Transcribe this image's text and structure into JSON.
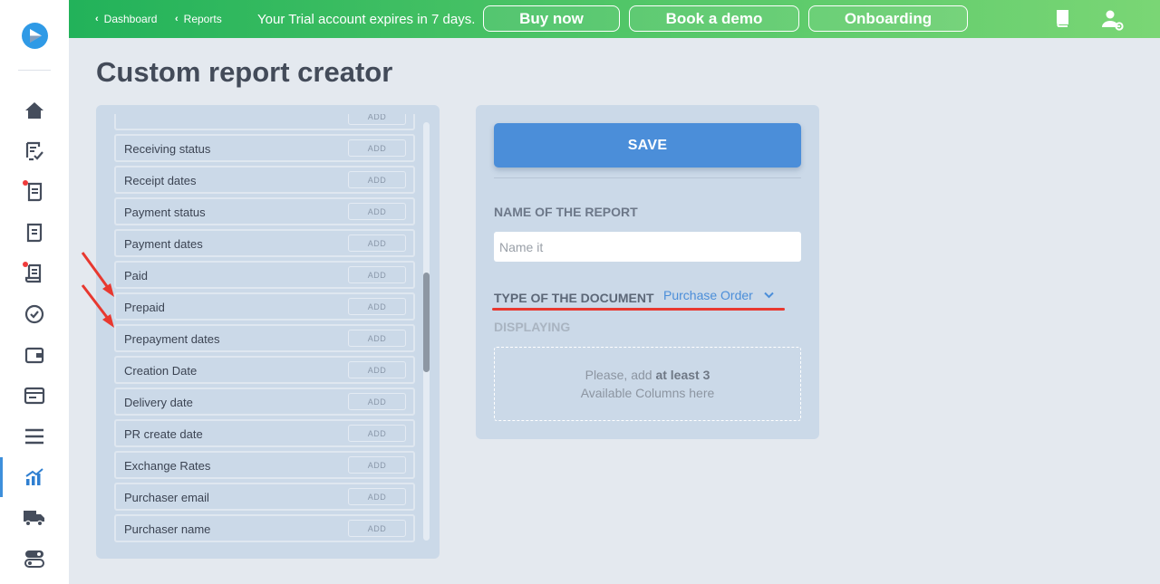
{
  "topbar": {
    "crumbs": [
      {
        "label": "Dashboard"
      },
      {
        "label": "Reports"
      }
    ],
    "trial_text": "Your Trial account expires in 7 days.",
    "buttons": {
      "buy_now": "Buy now",
      "book_demo": "Book a demo",
      "onboarding": "Onboarding"
    },
    "icons": [
      "book-icon",
      "user-settings-icon"
    ]
  },
  "sidebar": {
    "items": [
      {
        "icon": "home-icon"
      },
      {
        "icon": "document-check-icon"
      },
      {
        "icon": "document-notification-icon",
        "badge": true
      },
      {
        "icon": "document-icon"
      },
      {
        "icon": "receipt-notification-icon",
        "badge": true
      },
      {
        "icon": "check-circle-icon"
      },
      {
        "icon": "wallet-icon"
      },
      {
        "icon": "card-icon"
      },
      {
        "icon": "menu-icon"
      },
      {
        "icon": "chart-icon",
        "active": true
      },
      {
        "icon": "truck-icon"
      },
      {
        "icon": "toggle-icon"
      }
    ]
  },
  "page": {
    "title": "Custom report creator"
  },
  "columns": {
    "add_label": "ADD",
    "items": [
      "Receiving status",
      "Receipt dates",
      "Payment status",
      "Payment dates",
      "Paid",
      "Prepaid",
      "Prepayment dates",
      "Creation Date",
      "Delivery date",
      "PR create date",
      "Exchange Rates",
      "Purchaser email",
      "Purchaser name"
    ]
  },
  "report": {
    "save_label": "SAVE",
    "name_label": "NAME OF THE REPORT",
    "name_placeholder": "Name it",
    "name_value": "",
    "type_label": "TYPE OF THE DOCUMENT",
    "type_value": "Purchase Order",
    "displaying_label": "DISPLAYING",
    "drop_hint_prefix": "Please, add ",
    "drop_hint_bold": "at least 3",
    "drop_hint_line2": "Available Columns here"
  },
  "colors": {
    "accent": "#4b8ed9",
    "topbar_green": "#22b25a",
    "highlight_red": "#e8382f",
    "panel": "#cbd9e8"
  }
}
